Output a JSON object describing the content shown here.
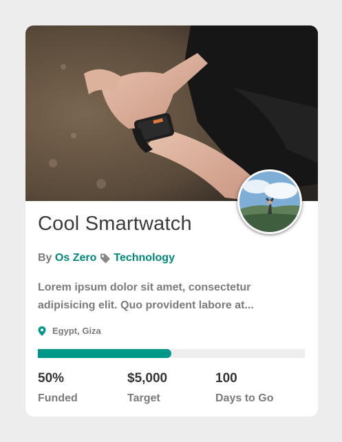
{
  "campaign": {
    "title": "Cool Smartwatch",
    "by_prefix": "By",
    "author": "Os Zero",
    "category": "Technology",
    "description": "Lorem ipsum dolor sit amet, consectetur adipisicing elit. Quo provident labore at...",
    "location": "Egypt, Giza",
    "progress_fraction": 0.5,
    "accent_color": "#009688",
    "icons": {
      "category": "tag-icon",
      "location": "map-pin-icon"
    }
  },
  "stats": [
    {
      "value": "50%",
      "label": "Funded"
    },
    {
      "value": "$5,000",
      "label": "Target"
    },
    {
      "value": "100",
      "label": "Days to Go"
    }
  ]
}
